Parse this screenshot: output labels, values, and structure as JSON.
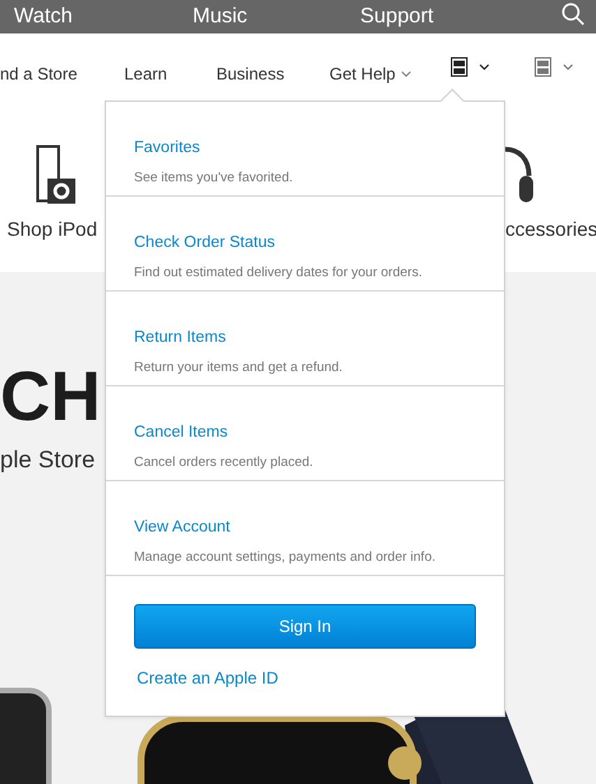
{
  "top_bar": {
    "items": [
      "Watch",
      "Music",
      "Support"
    ]
  },
  "nav": {
    "items": [
      {
        "label": "nd a Store",
        "dropdown": false
      },
      {
        "label": "Learn",
        "dropdown": false
      },
      {
        "label": "Business",
        "dropdown": false
      },
      {
        "label": "Get Help",
        "dropdown": true
      }
    ],
    "icon_menus": [
      {
        "expanded": true
      },
      {
        "expanded": false
      }
    ]
  },
  "products": [
    {
      "label": "Shop iPod"
    },
    {
      "label": "ccessories"
    }
  ],
  "hero": {
    "title": "CH",
    "subtitle": "ple Store"
  },
  "account_menu": {
    "items": [
      {
        "title": "Favorites",
        "description": "See items you've favorited."
      },
      {
        "title": "Check Order Status",
        "description": "Find out estimated delivery dates for your orders."
      },
      {
        "title": "Return Items",
        "description": "Return your items and get a refund."
      },
      {
        "title": "Cancel Items",
        "description": "Cancel orders recently placed."
      },
      {
        "title": "View Account",
        "description": "Manage account settings, payments and order info."
      }
    ],
    "sign_in": "Sign In",
    "create_link": "Create an Apple ID"
  }
}
